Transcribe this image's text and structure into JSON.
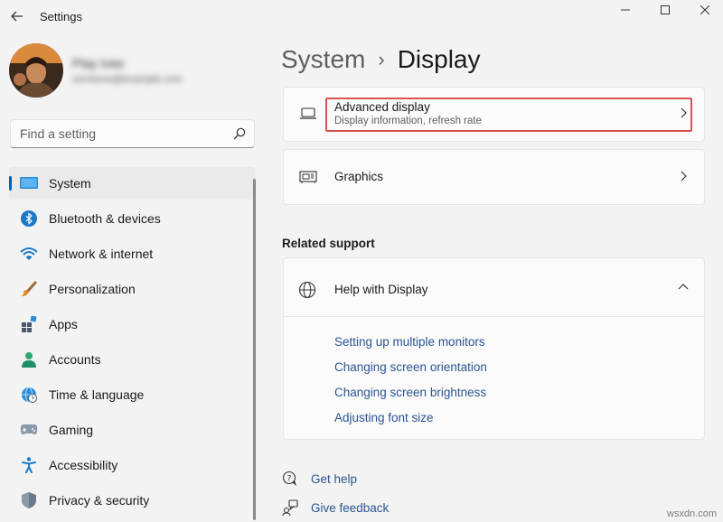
{
  "window": {
    "title": "Settings",
    "controls": {
      "minimize": "minimize",
      "maximize": "maximize",
      "close": "close"
    }
  },
  "profile": {
    "name": "Play Ivee",
    "email": "someone@example.com"
  },
  "search": {
    "placeholder": "Find a setting",
    "value": ""
  },
  "sidebar": {
    "items": [
      {
        "label": "System",
        "icon": "system-icon",
        "active": true
      },
      {
        "label": "Bluetooth & devices",
        "icon": "bluetooth-icon"
      },
      {
        "label": "Network & internet",
        "icon": "wifi-icon"
      },
      {
        "label": "Personalization",
        "icon": "brush-icon"
      },
      {
        "label": "Apps",
        "icon": "apps-icon"
      },
      {
        "label": "Accounts",
        "icon": "accounts-icon"
      },
      {
        "label": "Time & language",
        "icon": "globe-clock-icon"
      },
      {
        "label": "Gaming",
        "icon": "gamepad-icon"
      },
      {
        "label": "Accessibility",
        "icon": "accessibility-icon"
      },
      {
        "label": "Privacy & security",
        "icon": "shield-icon"
      }
    ]
  },
  "breadcrumb": {
    "parent": "System",
    "separator": "›",
    "current": "Display"
  },
  "settings": {
    "advanced": {
      "title": "Advanced display",
      "subtitle": "Display information, refresh rate"
    },
    "graphics": {
      "title": "Graphics"
    }
  },
  "related_support": {
    "heading": "Related support",
    "help": {
      "title": "Help with Display",
      "links": [
        "Setting up multiple monitors",
        "Changing screen orientation",
        "Changing screen brightness",
        "Adjusting font size"
      ]
    }
  },
  "footer_links": {
    "get_help": "Get help",
    "give_feedback": "Give feedback"
  },
  "watermark": "wsxdn.com",
  "colors": {
    "accent": "#0063b1",
    "link": "#2a5491",
    "highlight": "#d9534f"
  }
}
